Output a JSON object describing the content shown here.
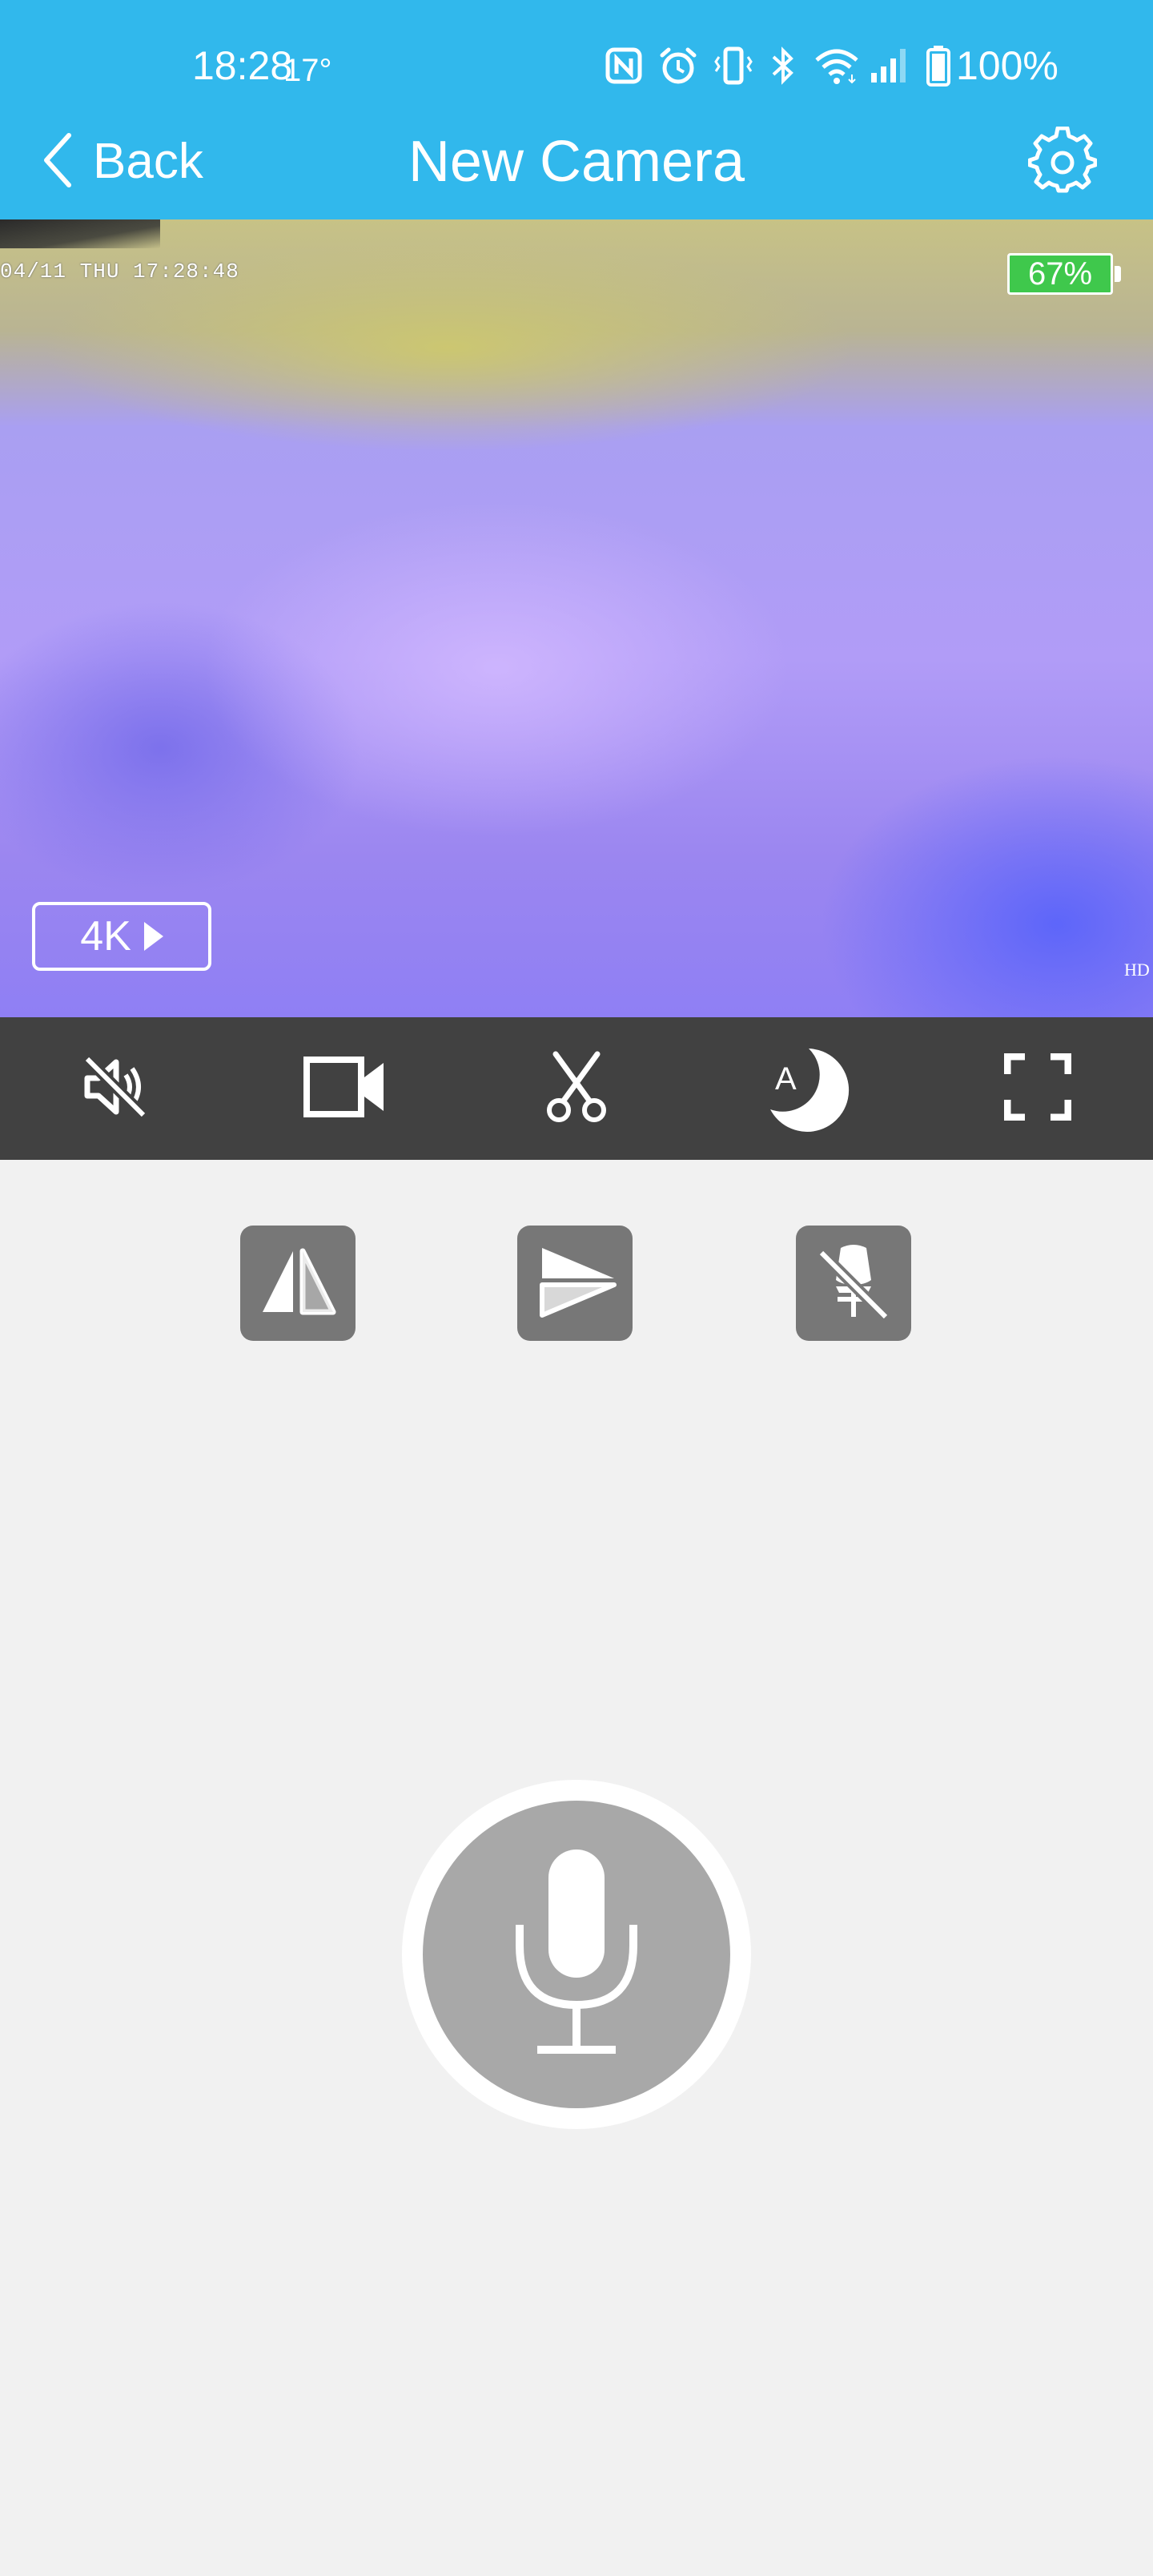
{
  "status_bar": {
    "time": "18:28",
    "temperature": "17°",
    "battery_percent": "100%",
    "icons": [
      "nfc-icon",
      "alarm-icon",
      "vibrate-icon",
      "bluetooth-icon",
      "wifi-icon",
      "signal-icon",
      "battery-icon"
    ]
  },
  "nav": {
    "back_label": "Back",
    "title": "New Camera",
    "settings_icon": "gear-icon"
  },
  "video": {
    "timestamp": "04/11 THU 17:28:48",
    "camera_battery": "67%",
    "quality_label": "4K",
    "hd_label": "HD"
  },
  "controls": [
    {
      "name": "mute-icon"
    },
    {
      "name": "record-video-icon"
    },
    {
      "name": "scissors-icon"
    },
    {
      "name": "night-mode-icon",
      "label": "A"
    },
    {
      "name": "fullscreen-icon"
    }
  ],
  "secondary_controls": [
    {
      "name": "flip-horizontal-icon"
    },
    {
      "name": "flip-vertical-icon"
    },
    {
      "name": "light-off-icon"
    }
  ],
  "microphone": {
    "icon": "microphone-icon"
  },
  "colors": {
    "header": "#31b8ec",
    "control_bar": "#414141",
    "background": "#f1f1f1",
    "secondary_button": "#777777",
    "mic_inner": "#a8a8a8",
    "camera_battery": "#3fc84c"
  }
}
